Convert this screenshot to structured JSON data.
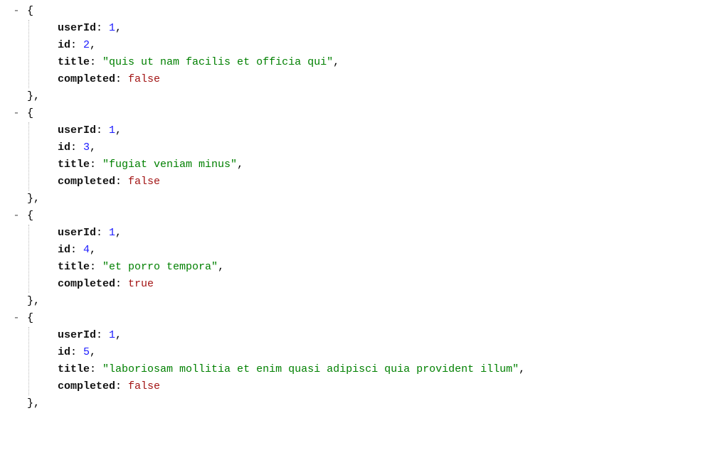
{
  "chart_data": {
    "type": "table",
    "title": "",
    "columns": [
      "userId",
      "id",
      "title",
      "completed"
    ],
    "rows": [
      [
        1,
        2,
        "quis ut nam facilis et officia qui",
        false
      ],
      [
        1,
        3,
        "fugiat veniam minus",
        false
      ],
      [
        1,
        4,
        "et porro tempora",
        true
      ],
      [
        1,
        5,
        "laboriosam mollitia et enim quasi adipisci quia provident illum",
        false
      ]
    ]
  },
  "collapse_glyph": "-",
  "brace_open": "{",
  "brace_close": "}",
  "comma": ",",
  "colon": ": ",
  "objects": [
    {
      "userId_key": "userId",
      "userId_val": "1",
      "id_key": "id",
      "id_val": "2",
      "title_key": "title",
      "title_val": "\"quis ut nam facilis et officia qui\"",
      "completed_key": "completed",
      "completed_val": "false"
    },
    {
      "userId_key": "userId",
      "userId_val": "1",
      "id_key": "id",
      "id_val": "3",
      "title_key": "title",
      "title_val": "\"fugiat veniam minus\"",
      "completed_key": "completed",
      "completed_val": "false"
    },
    {
      "userId_key": "userId",
      "userId_val": "1",
      "id_key": "id",
      "id_val": "4",
      "title_key": "title",
      "title_val": "\"et porro tempora\"",
      "completed_key": "completed",
      "completed_val": "true"
    },
    {
      "userId_key": "userId",
      "userId_val": "1",
      "id_key": "id",
      "id_val": "5",
      "title_key": "title",
      "title_val": "\"laboriosam mollitia et enim quasi adipisci quia provident illum\"",
      "completed_key": "completed",
      "completed_val": "false"
    }
  ]
}
